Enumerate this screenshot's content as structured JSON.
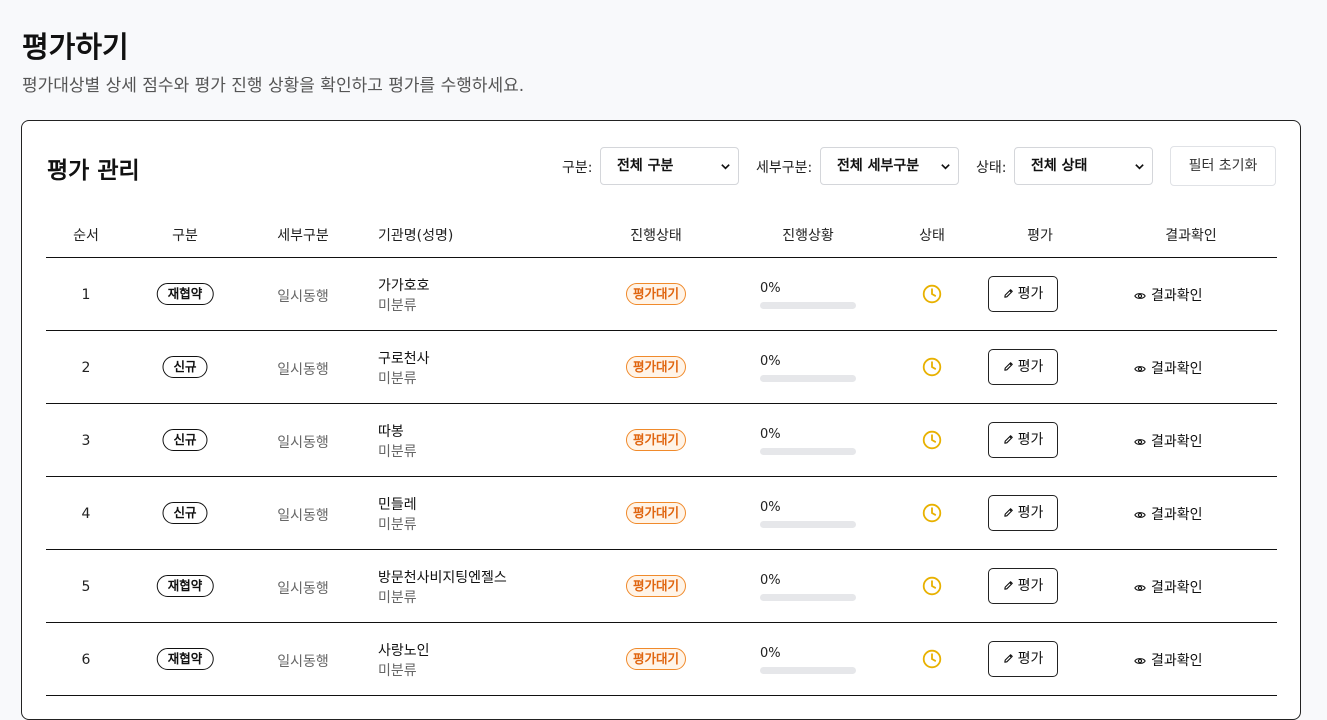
{
  "page": {
    "title": "평가하기",
    "subtitle": "평가대상별 상세 점수와 평가 진행 상황을 확인하고 평가를 수행하세요."
  },
  "card": {
    "title": "평가 관리",
    "filters": {
      "type_label": "구분:",
      "type_value": "전체 구분",
      "subtype_label": "세부구분:",
      "subtype_value": "전체 세부구분",
      "status_label": "상태:",
      "status_value": "전체 상태",
      "reset_label": "필터 초기화"
    }
  },
  "table": {
    "headers": [
      "순서",
      "구분",
      "세부구분",
      "기관명(성명)",
      "진행상태",
      "진행상황",
      "상태",
      "평가",
      "결과확인"
    ],
    "eval_label": "평가",
    "result_label": "결과확인",
    "rows": [
      {
        "num": "1",
        "type": "재협약",
        "subtype": "일시동행",
        "org": "가가호호",
        "category": "미분류",
        "progress": "평가대기",
        "pct_label": "0%",
        "pct": 0
      },
      {
        "num": "2",
        "type": "신규",
        "subtype": "일시동행",
        "org": "구로천사",
        "category": "미분류",
        "progress": "평가대기",
        "pct_label": "0%",
        "pct": 0
      },
      {
        "num": "3",
        "type": "신규",
        "subtype": "일시동행",
        "org": "따봉",
        "category": "미분류",
        "progress": "평가대기",
        "pct_label": "0%",
        "pct": 0
      },
      {
        "num": "4",
        "type": "신규",
        "subtype": "일시동행",
        "org": "민들레",
        "category": "미분류",
        "progress": "평가대기",
        "pct_label": "0%",
        "pct": 0
      },
      {
        "num": "5",
        "type": "재협약",
        "subtype": "일시동행",
        "org": "방문천사비지팅엔젤스",
        "category": "미분류",
        "progress": "평가대기",
        "pct_label": "0%",
        "pct": 0
      },
      {
        "num": "6",
        "type": "재협약",
        "subtype": "일시동행",
        "org": "사랑노인",
        "category": "미분류",
        "progress": "평가대기",
        "pct_label": "0%",
        "pct": 0
      }
    ]
  },
  "colors": {
    "pending_orange": "#e0650f",
    "clock_yellow": "#e8b100",
    "progress_track": "#e6e7ea"
  },
  "icons": {
    "status": "clock-icon",
    "eval": "pencil-icon",
    "result": "eye-icon",
    "select": "chevron-down-icon"
  }
}
